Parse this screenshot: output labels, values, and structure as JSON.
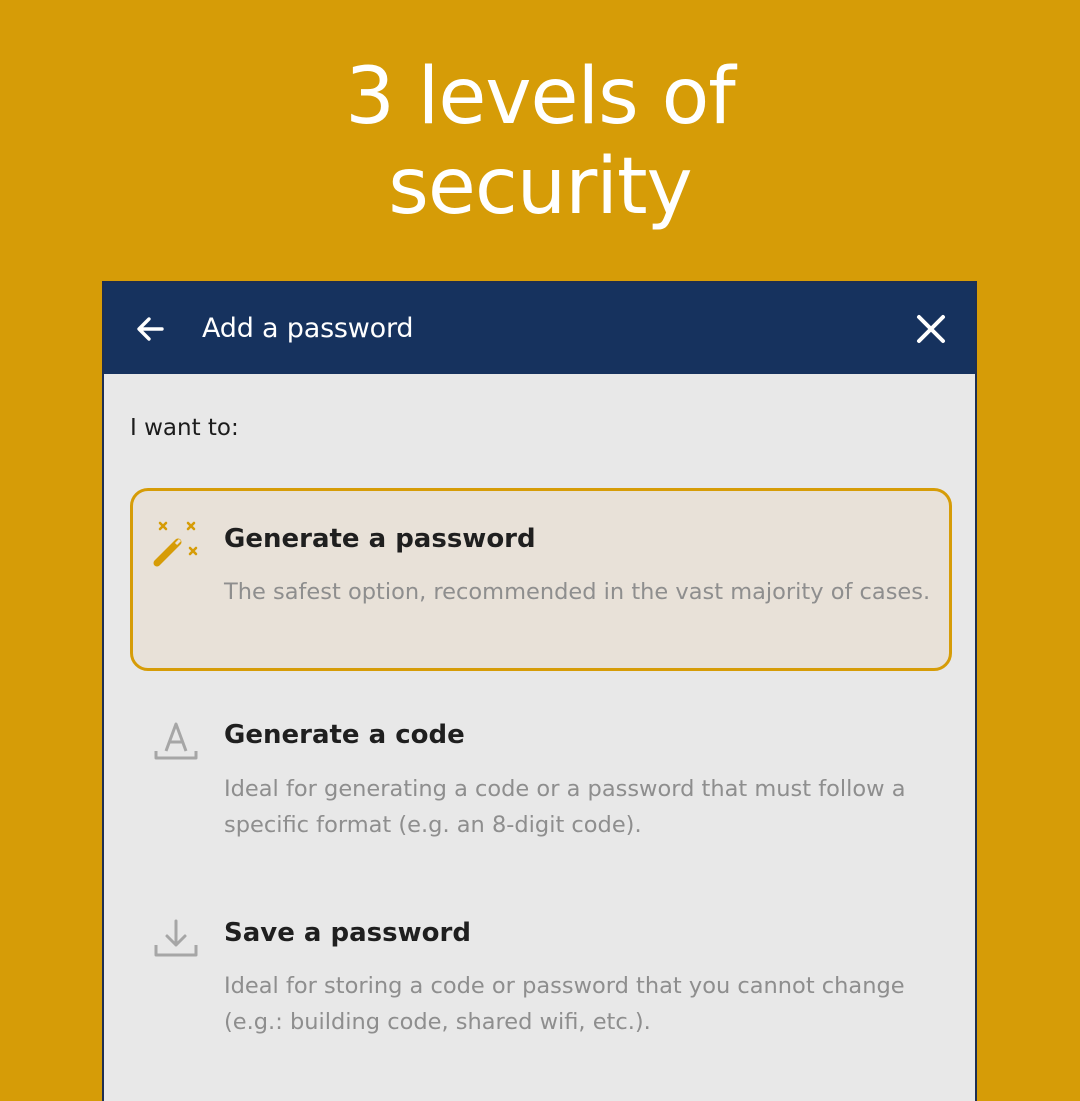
{
  "headline": {
    "line1": "3 levels of",
    "line2": "security"
  },
  "dialog": {
    "title": "Add a password",
    "back_icon": "arrow-left-icon",
    "close_icon": "close-icon"
  },
  "prompt": "I want to:",
  "options": [
    {
      "title": "Generate a password",
      "description": "The safest option, recommended in the vast majority of cases.",
      "icon": "magic-wand-icon",
      "selected": true
    },
    {
      "title": "Generate a code",
      "description": "Ideal for generating a code or a password that must follow a specific format (e.g. an 8-digit code).",
      "icon": "text-format-icon",
      "selected": false
    },
    {
      "title": "Save a password",
      "description": "Ideal for storing a code or password that you cannot change (e.g.: building code, shared wifi, etc.).",
      "icon": "download-icon",
      "selected": false
    }
  ],
  "colors": {
    "background": "#D69C07",
    "appbar": "#16325E",
    "panel": "#E8E8E8",
    "selected_fill": "#E8E1D8",
    "accent": "#D69C07"
  }
}
